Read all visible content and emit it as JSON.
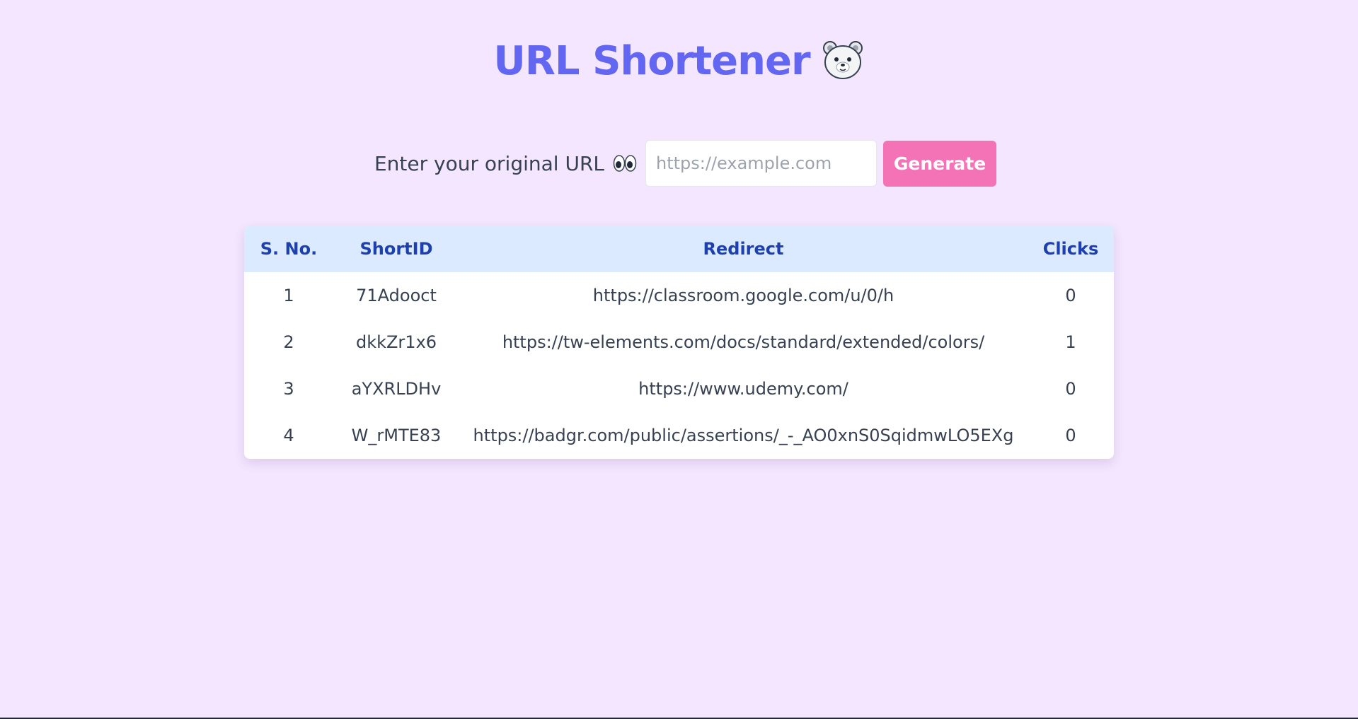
{
  "header": {
    "title": "URL Shortener",
    "icon": "bear-face-icon"
  },
  "form": {
    "label": "Enter your original URL",
    "label_icon": "eyes-icon",
    "input_value": "",
    "input_placeholder": "https://example.com",
    "generate_label": "Generate"
  },
  "table": {
    "headers": {
      "sno": "S. No.",
      "shortid": "ShortID",
      "redirect": "Redirect",
      "clicks": "Clicks"
    },
    "rows": [
      {
        "sno": "1",
        "shortid": "71Adooct",
        "redirect": "https://classroom.google.com/u/0/h",
        "clicks": "0"
      },
      {
        "sno": "2",
        "shortid": "dkkZr1x6",
        "redirect": "https://tw-elements.com/docs/standard/extended/colors/",
        "clicks": "1"
      },
      {
        "sno": "3",
        "shortid": "aYXRLDHv",
        "redirect": "https://www.udemy.com/",
        "clicks": "0"
      },
      {
        "sno": "4",
        "shortid": "W_rMTE83",
        "redirect": "https://badgr.com/public/assertions/_-_AO0xnS0SqidmwLO5EXg",
        "clicks": "0"
      }
    ]
  },
  "colors": {
    "background": "#f3e6fe",
    "title": "#6366f1",
    "button": "#f472b6",
    "table_header_bg": "#dbeafe",
    "table_header_text": "#1e40af"
  }
}
